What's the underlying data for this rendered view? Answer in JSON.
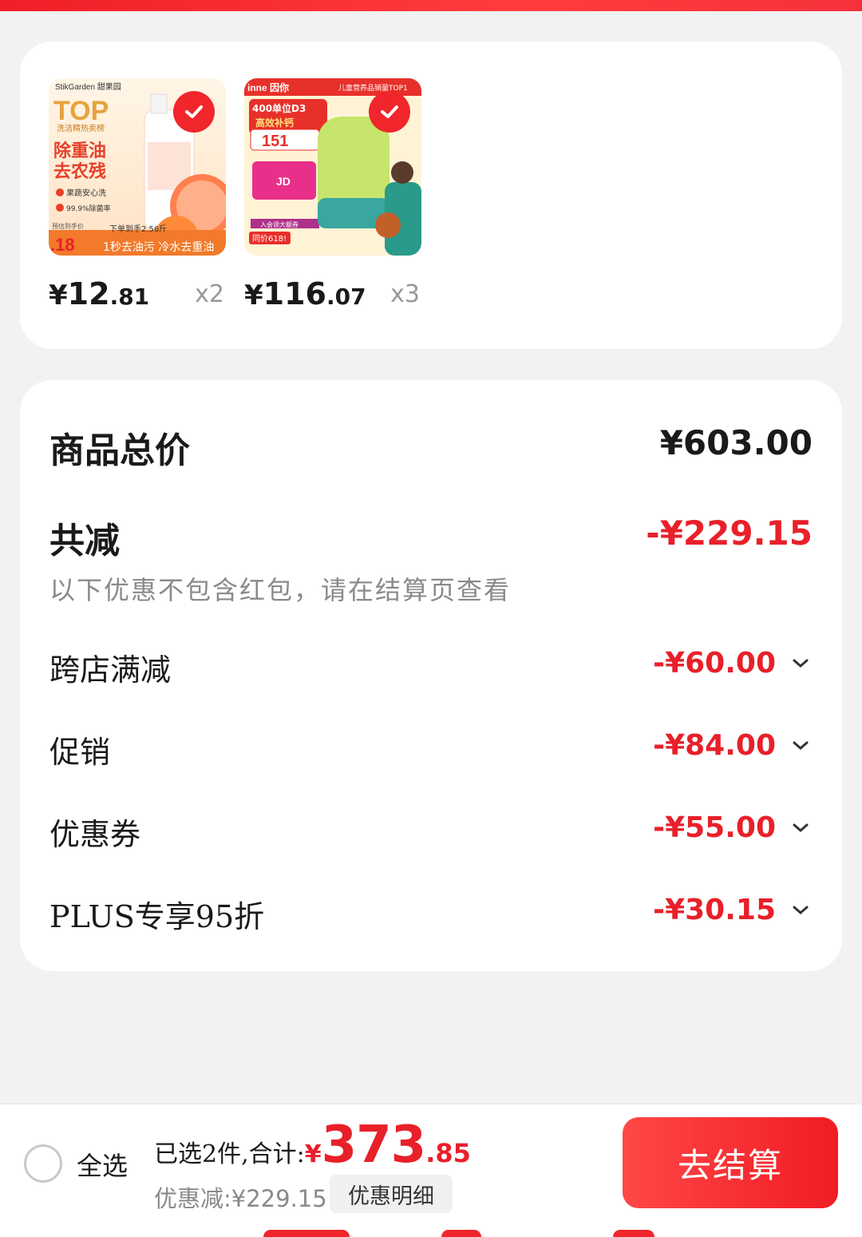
{
  "colors": {
    "accent": "#e8202a",
    "brand_red": "#f0262c"
  },
  "products": [
    {
      "image_label": "洗洁精商品图",
      "image_text": {
        "brand": "StikGarden 甜果园",
        "top": "TOP",
        "sub": "洗洁精热卖榜",
        "headline1": "除重油",
        "headline2": "去农残",
        "tag1": "果蔬安心洗",
        "tag2": "99.9%除菌率",
        "banner": "1秒去油污 冷水去重油",
        "hand": "下单到手2.56斤",
        "price": ".18",
        "pre": "预估到手价"
      },
      "selected": true,
      "price_yen": "¥",
      "price_int": "12",
      "price_dec": ".81",
      "qty": "x2"
    },
    {
      "image_label": "儿童钙商品图",
      "image_text": {
        "brand": "inne 因你",
        "rank": "儿童营养品销量TOP1",
        "headline1": "400单位D3",
        "headline2": "高效补钙",
        "price": "151",
        "card": "JD",
        "same": "同价618!",
        "vip": "入会领大额券"
      },
      "selected": true,
      "price_yen": "¥",
      "price_int": "116",
      "price_dec": ".07",
      "qty": "x3"
    }
  ],
  "summary": {
    "total_label": "商品总价",
    "total_value": "¥603.00",
    "reduce_label": "共减",
    "reduce_value": "-¥229.15",
    "note": "以下优惠不包含红包，请在结算页查看",
    "discounts": [
      {
        "label": "跨店满减",
        "value": "-¥60.00"
      },
      {
        "label": "促销",
        "value": "-¥84.00"
      },
      {
        "label": "优惠券",
        "value": "-¥55.00"
      },
      {
        "label": "PLUS专享95折",
        "value": "-¥30.15"
      }
    ]
  },
  "bottom": {
    "select_all": "全选",
    "selected_text": "已选2件,合计:",
    "sum_yen": "¥",
    "sum_int": "373",
    "sum_dec": ".85",
    "discount_text": "优惠减:¥229.15",
    "detail_button": "优惠明细",
    "checkout_button": "去结算"
  }
}
